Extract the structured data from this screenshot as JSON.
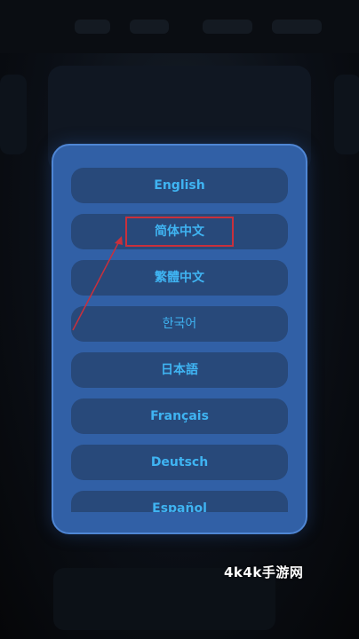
{
  "dialog": {
    "languages": [
      {
        "label": "English"
      },
      {
        "label": "简体中文"
      },
      {
        "label": "繁體中文"
      },
      {
        "label": "한국어"
      },
      {
        "label": "日本語"
      },
      {
        "label": "Français"
      },
      {
        "label": "Deutsch"
      },
      {
        "label": "Español"
      }
    ],
    "highlighted_index": 1
  },
  "watermark": {
    "text": "4k4k手游网"
  },
  "colors": {
    "dialog_bg": "#3160a6",
    "button_bg": "#28497a",
    "button_text": "#3fb4f2",
    "highlight": "#c8303c"
  }
}
